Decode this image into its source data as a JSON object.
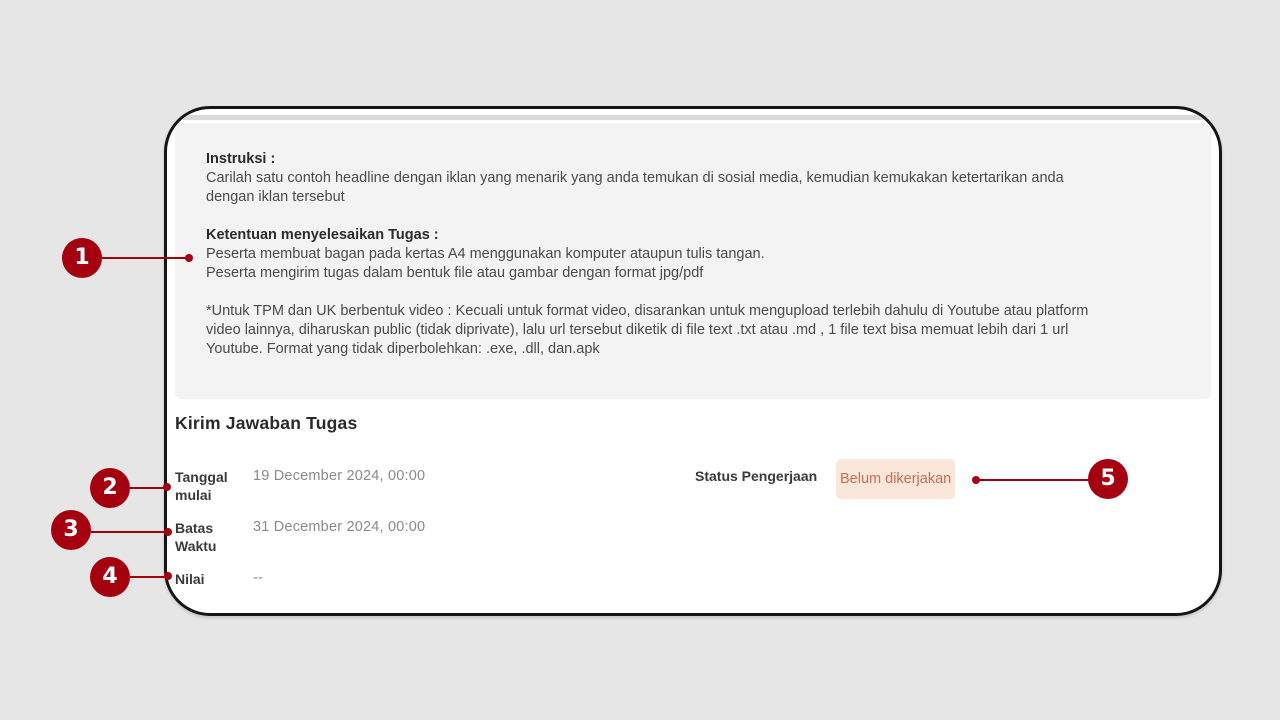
{
  "instructions": {
    "heading": "Instruksi  :",
    "line1": "Carilah satu contoh headline dengan iklan  yang menarik yang anda temukan di sosial media, kemudian kemukakan ketertarikan anda",
    "line2": "dengan iklan tersebut",
    "rules_heading": "Ketentuan menyelesaikan Tugas :",
    "rule1": "Peserta membuat bagan pada kertas A4 menggunakan komputer ataupun tulis tangan.",
    "rule2": "Peserta mengirim tugas dalam bentuk file atau gambar dengan format jpg/pdf",
    "note1": "*Untuk TPM dan UK berbentuk video : Kecuali untuk format video, disarankan untuk mengupload terlebih dahulu di Youtube atau platform",
    "note2": "video lainnya, diharuskan public (tidak diprivate), lalu url tersebut diketik di file text .txt atau .md , 1 file text bisa memuat lebih dari 1 url",
    "note3": "Youtube. Format yang tidak diperbolehkan: .exe, .dll, dan.apk"
  },
  "submission": {
    "title": "Kirim Jawaban Tugas",
    "start_label_1": "Tanggal",
    "start_label_2": "mulai",
    "start_value": "19 December 2024, 00:00",
    "deadline_label_1": "Batas",
    "deadline_label_2": "Waktu",
    "deadline_value": "31 December 2024, 00:00",
    "score_label": "Nilai",
    "score_value": "--",
    "status_label": "Status Pengerjaan",
    "status_value": "Belum dikerjakan",
    "status_color": "#c96c55",
    "status_bg": "#fbe6da"
  },
  "callouts": {
    "color": "#a40010",
    "c1": "1",
    "c2": "2",
    "c3": "3",
    "c4": "4",
    "c5": "5"
  }
}
